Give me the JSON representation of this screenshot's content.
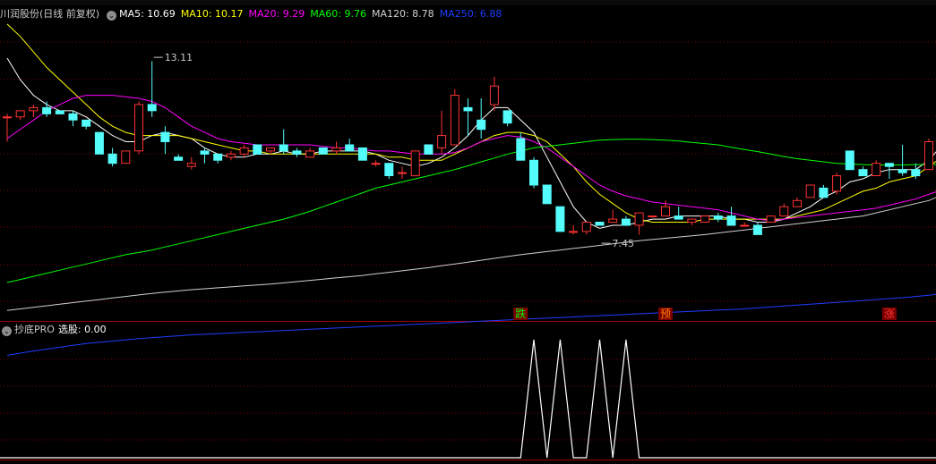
{
  "main_panel": {
    "title": "川润股份(日线 前复权)",
    "indicators": [
      {
        "label": "MA5: 10.69",
        "color": "#ffffff"
      },
      {
        "label": "MA10: 10.17",
        "color": "#ffff00"
      },
      {
        "label": "MA20: 9.29",
        "color": "#ff00ff"
      },
      {
        "label": "MA60: 9.76",
        "color": "#00ff00"
      },
      {
        "label": "MA120: 8.78",
        "color": "#d0d0d0"
      },
      {
        "label": "MA250: 6.88",
        "color": "#1e3cff"
      }
    ]
  },
  "sub_panel": {
    "title": "抄底PRO",
    "value_label": "选股: 0.00"
  },
  "colors": {
    "up": "#ff3232",
    "down": "#54fcfc",
    "grid": "#7a0000",
    "divider": "#a00000",
    "background": "#000000"
  },
  "chart_data": [
    {
      "type": "candlestick",
      "title": "川润股份(日线 前复权)",
      "y_range": [
        5.2,
        14.5
      ],
      "annotations": [
        {
          "text": "13.11",
          "index": 11,
          "value": 13.11
        },
        {
          "text": "7.45",
          "index": 45,
          "value": 7.45
        }
      ],
      "markers": [
        {
          "text": "跌",
          "index": 39,
          "color": "#00ff00"
        },
        {
          "text": "预",
          "index": 50,
          "color": "#ff8000"
        },
        {
          "text": "涨",
          "index": 67,
          "color": "#ff3232"
        }
      ],
      "candles": [
        [
          11.3,
          11.4,
          10.5,
          11.3
        ],
        [
          11.3,
          11.5,
          11.2,
          11.5
        ],
        [
          11.5,
          11.7,
          11.3,
          11.6
        ],
        [
          11.6,
          11.8,
          11.3,
          11.4
        ],
        [
          11.5,
          11.5,
          11.4,
          11.4
        ],
        [
          11.4,
          11.5,
          11.0,
          11.2
        ],
        [
          11.2,
          11.2,
          10.9,
          11.0
        ],
        [
          10.8,
          10.8,
          10.1,
          10.1
        ],
        [
          10.1,
          10.3,
          9.7,
          9.8
        ],
        [
          9.8,
          10.2,
          9.8,
          10.2
        ],
        [
          10.2,
          11.8,
          10.1,
          11.7
        ],
        [
          11.7,
          13.1,
          11.3,
          11.5
        ],
        [
          10.8,
          11.0,
          10.1,
          10.5
        ],
        [
          10.0,
          10.1,
          9.9,
          9.9
        ],
        [
          9.7,
          10.0,
          9.6,
          9.8
        ],
        [
          10.2,
          10.3,
          9.8,
          10.1
        ],
        [
          10.1,
          10.1,
          9.8,
          9.9
        ],
        [
          10.0,
          10.2,
          9.9,
          10.1
        ],
        [
          10.1,
          10.4,
          10.0,
          10.3
        ],
        [
          10.4,
          10.4,
          10.1,
          10.1
        ],
        [
          10.2,
          10.3,
          10.1,
          10.3
        ],
        [
          10.4,
          10.9,
          10.1,
          10.2
        ],
        [
          10.2,
          10.3,
          10.0,
          10.1
        ],
        [
          10.0,
          10.3,
          10.0,
          10.2
        ],
        [
          10.3,
          10.3,
          10.1,
          10.1
        ],
        [
          10.2,
          10.5,
          10.1,
          10.3
        ],
        [
          10.4,
          10.6,
          10.2,
          10.2
        ],
        [
          10.3,
          10.3,
          9.9,
          9.9
        ],
        [
          9.8,
          9.9,
          9.7,
          9.8
        ],
        [
          9.8,
          9.8,
          9.3,
          9.4
        ],
        [
          9.5,
          9.7,
          9.3,
          9.5
        ],
        [
          9.4,
          10.2,
          9.4,
          10.2
        ],
        [
          10.4,
          10.4,
          10.1,
          10.1
        ],
        [
          10.3,
          11.5,
          10.1,
          10.7
        ],
        [
          10.4,
          12.2,
          10.4,
          12.0
        ],
        [
          11.6,
          11.9,
          10.7,
          11.5
        ],
        [
          11.2,
          11.9,
          10.6,
          10.9
        ],
        [
          11.7,
          12.6,
          11.5,
          12.3
        ],
        [
          11.5,
          11.5,
          11.0,
          11.1
        ],
        [
          10.6,
          10.8,
          9.9,
          9.9
        ],
        [
          9.9,
          10.0,
          9.0,
          9.1
        ],
        [
          9.1,
          9.1,
          8.5,
          8.5
        ],
        [
          8.4,
          8.4,
          7.6,
          7.6
        ],
        [
          7.6,
          7.8,
          7.5,
          7.6
        ],
        [
          7.6,
          7.9,
          7.5,
          7.9
        ],
        [
          7.9,
          7.9,
          7.8,
          7.8
        ],
        [
          7.9,
          8.3,
          7.9,
          8.0
        ],
        [
          8.0,
          8.1,
          7.9,
          7.8
        ],
        [
          7.8,
          8.2,
          7.5,
          8.2
        ],
        [
          8.1,
          8.1,
          8.1,
          8.1
        ],
        [
          8.1,
          8.6,
          8.1,
          8.4
        ],
        [
          8.1,
          8.4,
          8.0,
          8.0
        ],
        [
          7.9,
          8.0,
          7.8,
          8.0
        ],
        [
          7.9,
          8.1,
          7.9,
          8.1
        ],
        [
          8.1,
          8.2,
          7.9,
          8.0
        ],
        [
          8.1,
          8.4,
          7.9,
          7.8
        ],
        [
          7.8,
          7.9,
          7.8,
          7.8
        ],
        [
          7.8,
          7.9,
          7.5,
          7.5
        ],
        [
          7.9,
          8.1,
          7.9,
          8.1
        ],
        [
          8.1,
          8.5,
          8.1,
          8.4
        ],
        [
          8.4,
          8.7,
          8.4,
          8.6
        ],
        [
          8.7,
          9.1,
          8.7,
          9.1
        ],
        [
          9.0,
          9.1,
          8.7,
          8.7
        ],
        [
          8.9,
          9.5,
          8.8,
          9.4
        ],
        [
          10.2,
          10.2,
          9.6,
          9.6
        ],
        [
          9.6,
          9.7,
          9.4,
          9.4
        ],
        [
          9.4,
          9.9,
          9.4,
          9.8
        ],
        [
          9.8,
          9.8,
          9.3,
          9.7
        ],
        [
          9.6,
          10.4,
          9.4,
          9.5
        ],
        [
          9.6,
          9.8,
          9.3,
          9.4
        ],
        [
          9.6,
          10.6,
          9.6,
          10.5
        ],
        [
          10.5,
          10.6,
          9.9,
          10.7
        ]
      ],
      "ma_series": [
        {
          "name": "MA5",
          "color": "#ffffff",
          "values": [
            13.2,
            12.5,
            12.0,
            11.7,
            11.5,
            11.5,
            11.3,
            11.0,
            10.7,
            10.5,
            10.5,
            10.7,
            10.8,
            10.7,
            10.6,
            10.3,
            10.1,
            10.0,
            10.0,
            10.1,
            10.1,
            10.2,
            10.1,
            10.1,
            10.2,
            10.2,
            10.2,
            10.2,
            10.1,
            9.9,
            9.8,
            9.7,
            9.8,
            10.0,
            10.3,
            10.7,
            11.2,
            11.6,
            11.6,
            11.2,
            10.8,
            10.0,
            9.2,
            8.4,
            7.9,
            7.7,
            7.8,
            7.8,
            7.9,
            8.0,
            8.0,
            8.1,
            8.1,
            8.1,
            8.1,
            8.0,
            8.0,
            7.9,
            7.9,
            8.0,
            8.2,
            8.4,
            8.7,
            8.9,
            9.2,
            9.3,
            9.5,
            9.6,
            9.6,
            9.6,
            9.9,
            10.4
          ]
        },
        {
          "name": "MA10",
          "color": "#ffff00",
          "values": [
            14.3,
            13.9,
            13.4,
            12.9,
            12.5,
            12.1,
            11.7,
            11.3,
            11.0,
            10.8,
            10.7,
            10.7,
            10.7,
            10.7,
            10.6,
            10.5,
            10.4,
            10.3,
            10.2,
            10.2,
            10.1,
            10.1,
            10.1,
            10.1,
            10.1,
            10.1,
            10.1,
            10.1,
            10.1,
            10.0,
            10.0,
            9.9,
            9.9,
            9.9,
            10.1,
            10.3,
            10.5,
            10.7,
            10.8,
            10.8,
            10.7,
            10.5,
            10.1,
            9.7,
            9.2,
            8.8,
            8.5,
            8.2,
            8.0,
            7.9,
            7.9,
            7.9,
            7.9,
            8.0,
            8.0,
            8.0,
            8.0,
            8.0,
            8.0,
            8.0,
            8.1,
            8.2,
            8.3,
            8.5,
            8.7,
            8.9,
            9.0,
            9.2,
            9.3,
            9.4,
            9.7,
            10.0
          ]
        },
        {
          "name": "MA20",
          "color": "#ff00ff",
          "values": [
            10.6,
            10.9,
            11.2,
            11.5,
            11.7,
            11.9,
            12.0,
            12.0,
            12.0,
            11.95,
            11.9,
            11.8,
            11.6,
            11.3,
            11.0,
            10.8,
            10.6,
            10.5,
            10.45,
            10.4,
            10.4,
            10.4,
            10.4,
            10.4,
            10.35,
            10.3,
            10.3,
            10.25,
            10.2,
            10.2,
            10.15,
            10.1,
            10.1,
            10.1,
            10.15,
            10.3,
            10.5,
            10.6,
            10.7,
            10.65,
            10.5,
            10.3,
            10.0,
            9.7,
            9.4,
            9.1,
            8.9,
            8.75,
            8.65,
            8.55,
            8.5,
            8.45,
            8.4,
            8.35,
            8.3,
            8.2,
            8.1,
            8.0,
            7.95,
            8.0,
            8.05,
            8.1,
            8.15,
            8.2,
            8.25,
            8.3,
            8.35,
            8.45,
            8.55,
            8.65,
            8.8,
            8.95
          ]
        },
        {
          "name": "MA60",
          "color": "#00ff00",
          "values": [
            5.95,
            6.05,
            6.15,
            6.25,
            6.35,
            6.45,
            6.55,
            6.65,
            6.75,
            6.85,
            6.92,
            7.0,
            7.1,
            7.2,
            7.3,
            7.4,
            7.5,
            7.6,
            7.7,
            7.8,
            7.9,
            8.0,
            8.12,
            8.25,
            8.4,
            8.55,
            8.7,
            8.85,
            9.0,
            9.1,
            9.2,
            9.3,
            9.4,
            9.5,
            9.6,
            9.72,
            9.85,
            9.97,
            10.1,
            10.2,
            10.3,
            10.35,
            10.4,
            10.45,
            10.5,
            10.55,
            10.57,
            10.58,
            10.58,
            10.57,
            10.55,
            10.52,
            10.48,
            10.44,
            10.4,
            10.32,
            10.25,
            10.18,
            10.1,
            10.02,
            9.95,
            9.9,
            9.85,
            9.8,
            9.78,
            9.76,
            9.75,
            9.75,
            9.75,
            9.76,
            9.76,
            9.77
          ]
        },
        {
          "name": "MA120",
          "color": "#d0d0d0",
          "values": [
            5.05,
            5.1,
            5.15,
            5.2,
            5.25,
            5.3,
            5.35,
            5.4,
            5.45,
            5.5,
            5.55,
            5.6,
            5.64,
            5.68,
            5.72,
            5.75,
            5.78,
            5.81,
            5.84,
            5.87,
            5.9,
            5.94,
            5.98,
            6.02,
            6.06,
            6.1,
            6.14,
            6.18,
            6.23,
            6.28,
            6.33,
            6.38,
            6.43,
            6.49,
            6.55,
            6.61,
            6.67,
            6.73,
            6.79,
            6.85,
            6.9,
            6.95,
            7.0,
            7.05,
            7.1,
            7.15,
            7.2,
            7.25,
            7.3,
            7.34,
            7.38,
            7.42,
            7.46,
            7.5,
            7.55,
            7.6,
            7.65,
            7.7,
            7.75,
            7.8,
            7.85,
            7.9,
            7.95,
            8.0,
            8.05,
            8.1,
            8.2,
            8.3,
            8.4,
            8.5,
            8.6,
            8.78
          ]
        },
        {
          "name": "MA250",
          "color": "#1e3cff",
          "values": [
            3.6,
            3.67,
            3.74,
            3.8,
            3.86,
            3.92,
            3.98,
            4.02,
            4.06,
            4.1,
            4.14,
            4.17,
            4.2,
            4.23,
            4.26,
            4.28,
            4.3,
            4.32,
            4.34,
            4.36,
            4.38,
            4.4,
            4.42,
            4.44,
            4.46,
            4.48,
            4.5,
            4.52,
            4.54,
            4.56,
            4.58,
            4.6,
            4.62,
            4.64,
            4.66,
            4.68,
            4.7,
            4.72,
            4.74,
            4.76,
            4.78,
            4.8,
            4.82,
            4.84,
            4.86,
            4.88,
            4.9,
            4.92,
            4.94,
            4.96,
            4.98,
            5.0,
            5.02,
            5.04,
            5.06,
            5.08,
            5.1,
            5.13,
            5.16,
            5.19,
            5.22,
            5.25,
            5.28,
            5.31,
            5.34,
            5.37,
            5.4,
            5.43,
            5.46,
            5.5,
            5.54,
            5.6
          ]
        }
      ]
    },
    {
      "type": "line",
      "title": "抄底PRO",
      "y_range": [
        0,
        1
      ],
      "series": [
        {
          "color": "#ffffff",
          "values": [
            0,
            0,
            0,
            0,
            0,
            0,
            0,
            0,
            0,
            0,
            0,
            0,
            0,
            0,
            0,
            0,
            0,
            0,
            0,
            0,
            0,
            0,
            0,
            0,
            0,
            0,
            0,
            0,
            0,
            0,
            0,
            0,
            0,
            0,
            0,
            0,
            0,
            0,
            0,
            0,
            1,
            0,
            1,
            0,
            0,
            1,
            0,
            1,
            0,
            0,
            0,
            0,
            0,
            0,
            0,
            0,
            0,
            0,
            0,
            0,
            0,
            0,
            0,
            0,
            0,
            0,
            0,
            0,
            0,
            0,
            0,
            0
          ]
        }
      ]
    }
  ]
}
